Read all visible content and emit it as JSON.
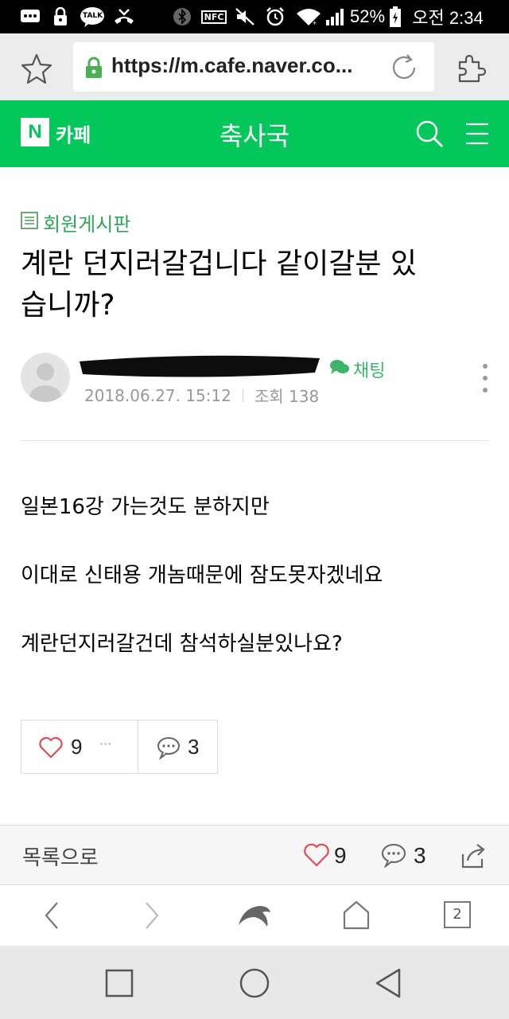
{
  "status_bar": {
    "talk_icon_text": "TALK",
    "nfc_text": "NFC",
    "battery": "52%",
    "time": "오전 2:34"
  },
  "browser": {
    "url": "https://m.cafe.naver.co...",
    "tabs_count": "2"
  },
  "cafe_header": {
    "logo_letter": "N",
    "service_label": "카페",
    "cafe_name": "축사국"
  },
  "post": {
    "board_name": "회원게시판",
    "title_line1": "계란 던지러갈겁니다 같이갈분 있",
    "title_line2": "습니까?",
    "chat_label": "채팅",
    "date": "2018.06.27. 15:12",
    "views_label": "조회 138",
    "body": [
      "일본16강 가는것도 분하지만",
      "이대로 신태용 개놈때문에 잠도못자겠네요",
      "계란던지러갈건데 참석하실분있나요?"
    ],
    "like_count": "9",
    "comment_count": "3",
    "more_dots": "···"
  },
  "footer": {
    "back_to_list": "목록으로",
    "like_count": "9",
    "comment_count": "3"
  },
  "colors": {
    "brand_green": "#03c75a",
    "like_red": "#e24a5a"
  }
}
